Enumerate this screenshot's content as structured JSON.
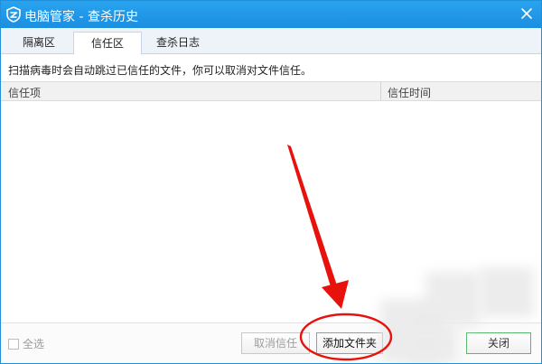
{
  "window": {
    "title": "电脑管家 - 查杀历史",
    "close_glyph": "×"
  },
  "tabs": [
    {
      "label": "隔离区",
      "active": false
    },
    {
      "label": "信任区",
      "active": true
    },
    {
      "label": "查杀日志",
      "active": false
    }
  ],
  "hint": "扫描病毒时会自动跳过已信任的文件，你可以取消对文件信任。",
  "table": {
    "columns": [
      "信任项",
      "信任时间"
    ],
    "rows": []
  },
  "footer": {
    "select_all_label": "全选",
    "untrust_label": "取消信任",
    "add_folder_label": "添加文件夹",
    "close_label": "关闭"
  },
  "colors": {
    "titlebar": "#1b8ee0",
    "annotation_red": "#e8120c",
    "close_border": "#58b96a"
  },
  "icons": {
    "app": "shield-logo-icon",
    "close": "close-icon",
    "checkbox": "checkbox-icon"
  }
}
